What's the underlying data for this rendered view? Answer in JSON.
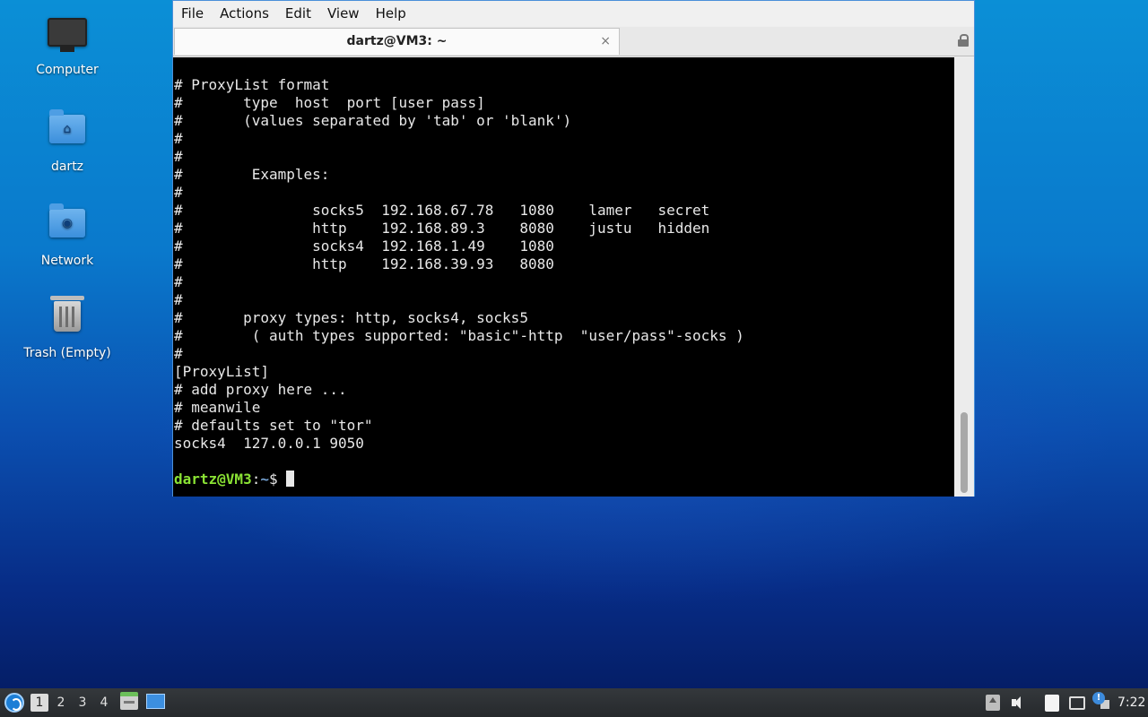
{
  "desktop": {
    "icons": [
      {
        "label": "Computer",
        "icon": "computer-icon"
      },
      {
        "label": "dartz",
        "icon": "home-folder-icon"
      },
      {
        "label": "Network",
        "icon": "network-folder-icon"
      },
      {
        "label": "Trash (Empty)",
        "icon": "trash-icon"
      }
    ]
  },
  "window": {
    "menu": [
      "File",
      "Actions",
      "Edit",
      "View",
      "Help"
    ],
    "tab": {
      "title": "dartz@VM3: ~",
      "close": "×"
    },
    "terminal": {
      "lines": [
        "# ProxyList format",
        "#       type  host  port [user pass]",
        "#       (values separated by 'tab' or 'blank')",
        "#",
        "#",
        "#        Examples:",
        "#",
        "#               socks5  192.168.67.78   1080    lamer   secret",
        "#               http    192.168.89.3    8080    justu   hidden",
        "#               socks4  192.168.1.49    1080",
        "#               http    192.168.39.93   8080",
        "#",
        "#",
        "#       proxy types: http, socks4, socks5",
        "#        ( auth types supported: \"basic\"-http  \"user/pass\"-socks )",
        "#",
        "[ProxyList]",
        "# add proxy here ...",
        "# meanwile",
        "# defaults set to \"tor\"",
        "socks4  127.0.0.1 9050",
        ""
      ],
      "prompt": {
        "user": "dartz@VM3",
        "sep": ":",
        "path": "~",
        "symbol": "$ "
      }
    }
  },
  "taskbar": {
    "workspaces": [
      "1",
      "2",
      "3",
      "4"
    ],
    "active_workspace": "1",
    "notification_badge": "!",
    "clock": "7:22"
  }
}
